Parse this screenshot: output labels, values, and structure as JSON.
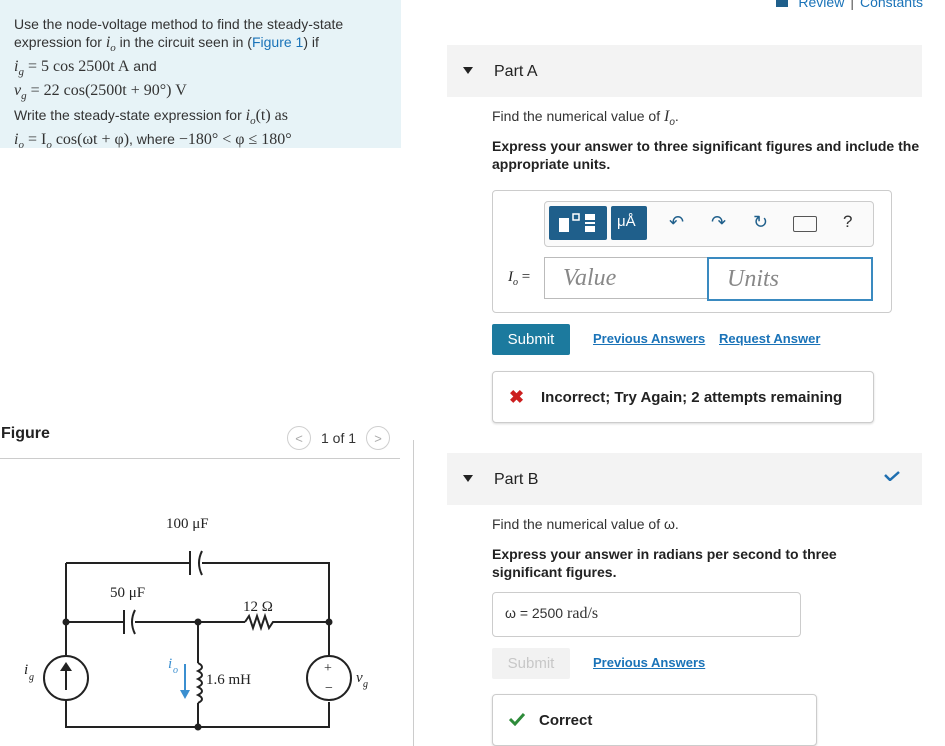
{
  "header": {
    "review_label": "Review",
    "separator": "|",
    "constants_label": "Constants"
  },
  "problem": {
    "line1": "Use the node-voltage method to find the steady-state",
    "line2_pre": "expression for ",
    "line2_var": "i",
    "line2_sub": "o",
    "line2_mid": " in the circuit seen in (",
    "figure_link": "Figure 1",
    "line2_post": ") if",
    "ig_expr": "= 5 cos 2500t A",
    "ig_and": " and",
    "vg_expr": "= 22 cos(2500t + 90°) V",
    "line5": "Write the steady-state expression for ",
    "line5_expr": "(t) as",
    "io_expr": "= I",
    "io_expr2": " cos(ωt + φ)",
    "io_where": ", where ",
    "io_range": "−180° < φ ≤ 180°"
  },
  "figure": {
    "title": "Figure",
    "pager_text": "1 of 1",
    "labels": {
      "c1": "100 μF",
      "c2": "50 μF",
      "r": "12 Ω",
      "l": "1.6 mH",
      "ig": "i",
      "ig_sub": "g",
      "io": "i",
      "io_sub": "o",
      "vg": "v",
      "vg_sub": "g",
      "plus": "+",
      "minus": "−"
    }
  },
  "partA": {
    "label": "Part A",
    "prompt_pre": "Find the numerical value of ",
    "prompt_var": "I",
    "prompt_sub": "o",
    "prompt_post": ".",
    "instruction": "Express your answer to three significant figures and include the appropriate units.",
    "toolbar": {
      "micro_label": "μÅ",
      "help_label": "?"
    },
    "answer_label_var": "I",
    "answer_label_sub": "o",
    "answer_label_eq": " =",
    "value_placeholder": "Value",
    "units_placeholder": "Units",
    "submit_label": "Submit",
    "previous_answers": "Previous Answers",
    "request_answer": "Request Answer",
    "feedback": "Incorrect; Try Again; 2 attempts remaining",
    "feedback_color": "#cc1f1f"
  },
  "partB": {
    "label": "Part B",
    "prompt": "Find the numerical value of ω.",
    "instruction": "Express your answer in radians per second to three significant figures.",
    "answer_prefix": "ω = ",
    "answer_value": "2500",
    "answer_unit": " rad/s",
    "submit_label": "Submit",
    "previous_answers": "Previous Answers",
    "feedback": "Correct",
    "feedback_color": "#2e8b3a",
    "status": "correct"
  }
}
